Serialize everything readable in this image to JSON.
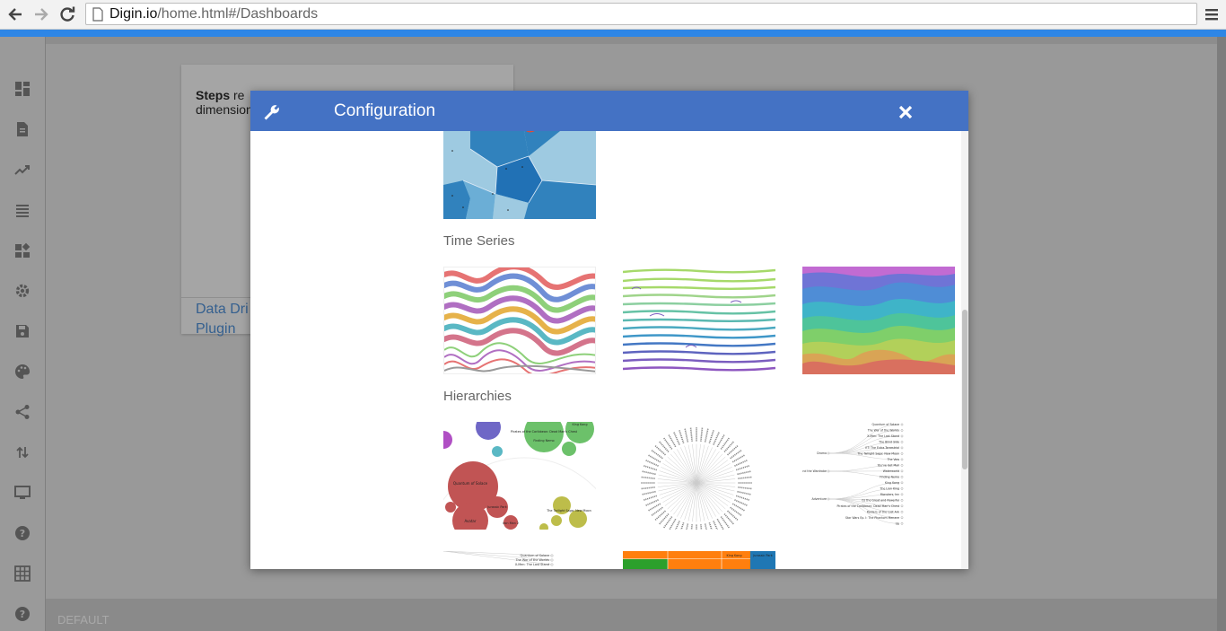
{
  "browser": {
    "url_domain": "Digin.io",
    "url_path": "/home.html#/Dashboards"
  },
  "card": {
    "steps_bold": "Steps",
    "steps_rest": " re",
    "steps_line2": "dimension",
    "link1": "Data Dri",
    "link2": "Plugin"
  },
  "footer": {
    "label": "DEFAULT"
  },
  "modal": {
    "title": "Configuration",
    "sections": {
      "time_series": "Time Series",
      "hierarchies": "Hierarchies"
    },
    "thumbnails": {
      "bubble_labels": [
        "Pirates of the Caribbean: Dead Man's Chest",
        "Quantum of Solace",
        "The Twilight Saga: New Moon",
        "Avatar",
        "Iron Man 2",
        "Jurassic Park",
        "King Kong",
        "Finding Nemo"
      ],
      "tree_labels": [
        "Quantum of Solace",
        "The War of the Worlds",
        "X-Men: The Last Stand",
        "The Blind Side",
        "ET: The Extra-Terrestrial",
        "The Twilight Saga: New Moon",
        "The Vow",
        "You've Got Mail",
        "Waterworld",
        "Finding Nemo",
        "King Kong",
        "The Lion King",
        "Monsters, Inc",
        "Oz the Great and Powerful",
        "Pirates of the Caribbean: Dead Man's Chest",
        "Raiders of the Lost Ark",
        "Star Wars Ep. I: The Phantom Menace",
        "Up"
      ],
      "tree_roots": [
        "Drama",
        "The Chronicles of Narnia: The Lion, the Witch and the Wardrobe",
        "Adventure"
      ],
      "lower_tree_labels": [
        "Quantum of Solace",
        "The War of the Worlds",
        "X-Men: The Last Stand"
      ],
      "treemap_labels": [
        "King Kong",
        "Jurassic Park"
      ]
    }
  },
  "colors": {
    "header_blue": "#4472c4",
    "top_strip": "#2e86e6",
    "link_blue": "#35608f"
  }
}
